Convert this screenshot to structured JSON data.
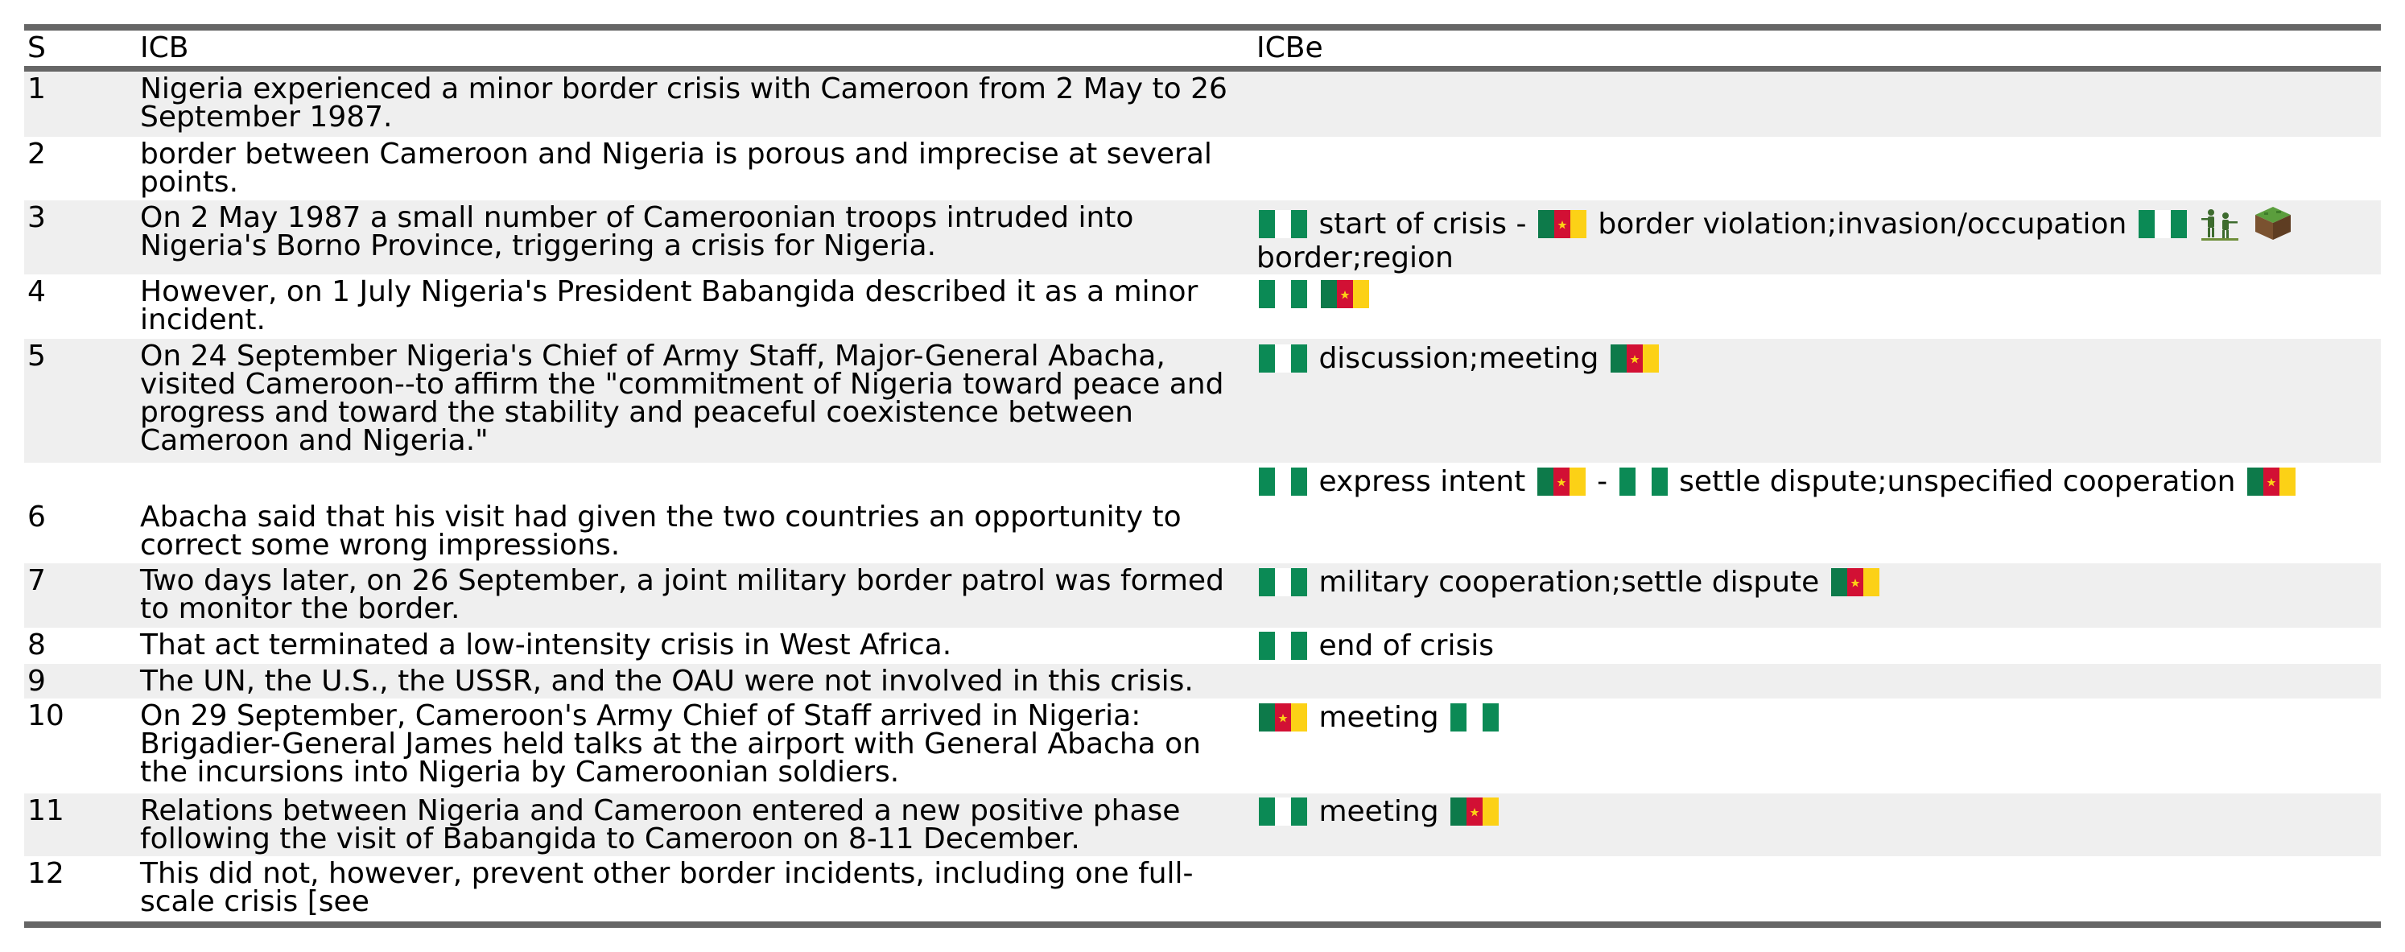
{
  "colors": {
    "rule": "#666666",
    "row_shade": "#efefef",
    "nigeria_green": "#0b8a55",
    "cameroon_green": "#0d7a4a",
    "cameroon_red": "#d21034",
    "cameroon_yellow": "#fcd116"
  },
  "header": {
    "s": "S",
    "icb": "ICB",
    "icbe": "ICBe"
  },
  "rows": [
    {
      "s": "1",
      "icb": "Nigeria experienced a minor border crisis with Cameroon from 2 May to 26 September 1987.",
      "icbe": []
    },
    {
      "s": "2",
      "icb": "border between Cameroon and Nigeria is porous and imprecise at several points.",
      "icbe": []
    },
    {
      "s": "3",
      "icb": "On 2 May 1987 a small number of Cameroonian troops intruded into Nigeria's Borno Province, triggering a crisis for Nigeria.",
      "icbe": [
        {
          "type": "flag",
          "icon": "nigeria-flag"
        },
        {
          "type": "text",
          "text": "start of crisis -"
        },
        {
          "type": "flag",
          "icon": "cameroon-flag"
        },
        {
          "type": "text",
          "text": "border violation;invasion/occupation"
        },
        {
          "type": "flag",
          "icon": "nigeria-flag"
        },
        {
          "type": "icon",
          "icon": "soldiers-icon"
        },
        {
          "type": "icon",
          "icon": "land-block-icon"
        },
        {
          "type": "text",
          "text": "border;region"
        }
      ]
    },
    {
      "s": "4",
      "icb": "However, on 1 July Nigeria's President Babangida described it as a minor incident.",
      "icbe": [
        {
          "type": "flag",
          "icon": "nigeria-flag"
        },
        {
          "type": "flag",
          "icon": "cameroon-flag"
        }
      ]
    },
    {
      "s": "5",
      "icb": "On 24 September Nigeria's Chief of Army Staff, Major-General Abacha, visited Cameroon--to affirm the \"commitment of Nigeria toward peace and progress and toward the stability and peaceful coexistence between Cameroon and Nigeria.\"",
      "icbe": [
        {
          "type": "flag",
          "icon": "nigeria-flag"
        },
        {
          "type": "text",
          "text": "discussion;meeting"
        },
        {
          "type": "flag",
          "icon": "cameroon-flag"
        }
      ]
    },
    {
      "s": "6",
      "icb": "Abacha said that his visit had given the two countries an opportunity to correct some wrong impressions.",
      "icbe": [
        {
          "type": "flag",
          "icon": "nigeria-flag"
        },
        {
          "type": "text",
          "text": "express intent"
        },
        {
          "type": "flag",
          "icon": "cameroon-flag"
        },
        {
          "type": "text",
          "text": "-"
        },
        {
          "type": "flag",
          "icon": "nigeria-flag"
        },
        {
          "type": "text",
          "text": "settle dispute;unspecified cooperation"
        },
        {
          "type": "flag",
          "icon": "cameroon-flag"
        }
      ]
    },
    {
      "s": "7",
      "icb": "Two days later, on 26 September, a joint military border patrol was formed to monitor the border.",
      "icbe": [
        {
          "type": "flag",
          "icon": "nigeria-flag"
        },
        {
          "type": "text",
          "text": "military cooperation;settle dispute"
        },
        {
          "type": "flag",
          "icon": "cameroon-flag"
        }
      ]
    },
    {
      "s": "8",
      "icb": "That act terminated a low-intensity crisis in West Africa.",
      "icbe": [
        {
          "type": "flag",
          "icon": "nigeria-flag"
        },
        {
          "type": "text",
          "text": "end of crisis"
        }
      ]
    },
    {
      "s": "9",
      "icb": "The UN, the U.S., the USSR, and the OAU were not involved in this crisis.",
      "icbe": []
    },
    {
      "s": "10",
      "icb": "On 29 September, Cameroon's Army Chief of Staff arrived in Nigeria: Brigadier-General James held talks at the airport with General Abacha on the incursions into Nigeria by Cameroonian soldiers.",
      "icbe": [
        {
          "type": "flag",
          "icon": "cameroon-flag"
        },
        {
          "type": "text",
          "text": "meeting"
        },
        {
          "type": "flag",
          "icon": "nigeria-flag"
        }
      ]
    },
    {
      "s": "11",
      "icb": "Relations between Nigeria and Cameroon entered a new positive phase following the visit of Babangida to Cameroon on 8-11 December.",
      "icbe": [
        {
          "type": "flag",
          "icon": "nigeria-flag"
        },
        {
          "type": "text",
          "text": "meeting"
        },
        {
          "type": "flag",
          "icon": "cameroon-flag"
        }
      ]
    },
    {
      "s": "12",
      "icb": "This did not, however, prevent other border incidents, including one full-scale crisis [see",
      "icbe": []
    }
  ]
}
